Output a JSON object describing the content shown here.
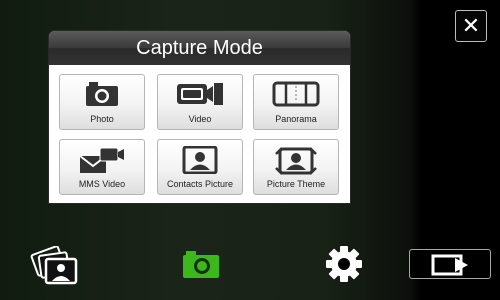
{
  "dialog": {
    "title": "Capture Mode",
    "modes": [
      {
        "label": "Photo",
        "icon": "camera-icon"
      },
      {
        "label": "Video",
        "icon": "video-camera-icon"
      },
      {
        "label": "Panorama",
        "icon": "panorama-icon"
      },
      {
        "label": "MMS Video",
        "icon": "mms-video-icon"
      },
      {
        "label": "Contacts Picture",
        "icon": "contact-portrait-icon"
      },
      {
        "label": "Picture Theme",
        "icon": "picture-theme-icon"
      }
    ]
  },
  "toolbar": {
    "close_icon": "close-icon",
    "gallery_icon": "photo-gallery-icon",
    "camera_icon": "camera-icon",
    "settings_icon": "gear-icon",
    "next_icon": "arrow-right-icon",
    "camera_accent": "#3cb71c"
  },
  "colors": {
    "background": "#1a2418",
    "title_bar": "#3a3a3a"
  }
}
